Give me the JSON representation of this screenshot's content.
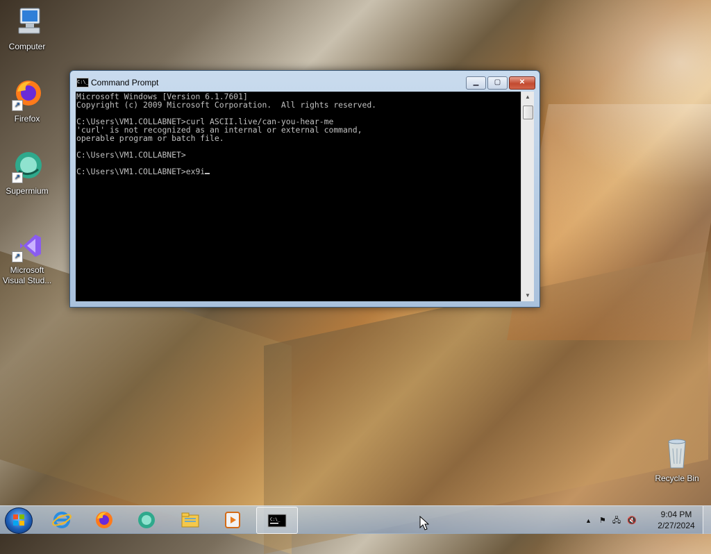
{
  "desktop": {
    "icons": [
      {
        "label": "Computer",
        "icon": "computer-icon"
      },
      {
        "label": "Firefox",
        "icon": "firefox-icon"
      },
      {
        "label": "Supermium",
        "icon": "supermium-icon"
      },
      {
        "label": "Microsoft Visual Stud...",
        "icon": "visual-studio-icon"
      },
      {
        "label": "Recycle Bin",
        "icon": "recycle-bin-icon"
      }
    ]
  },
  "window": {
    "title": "Command Prompt",
    "controls": {
      "minimize": "minimize",
      "maximize": "maximize",
      "close": "close"
    },
    "console": {
      "lines": [
        "Microsoft Windows [Version 6.1.7601]",
        "Copyright (c) 2009 Microsoft Corporation.  All rights reserved.",
        "",
        "C:\\Users\\VM1.COLLABNET>curl ASCII.live/can-you-hear-me",
        "'curl' is not recognized as an internal or external command,",
        "operable program or batch file.",
        "",
        "C:\\Users\\VM1.COLLABNET>",
        ""
      ],
      "prompt": "C:\\Users\\VM1.COLLABNET>",
      "current_input": "ex9i"
    }
  },
  "taskbar": {
    "start": "start-orb-icon",
    "pinned": [
      {
        "name": "internet-explorer-icon"
      },
      {
        "name": "firefox-icon"
      },
      {
        "name": "supermium-icon"
      },
      {
        "name": "file-explorer-icon"
      },
      {
        "name": "media-player-icon"
      },
      {
        "name": "command-prompt-icon",
        "active": true
      }
    ],
    "clock": {
      "time": "9:04 PM",
      "date": "2/27/2024"
    }
  }
}
